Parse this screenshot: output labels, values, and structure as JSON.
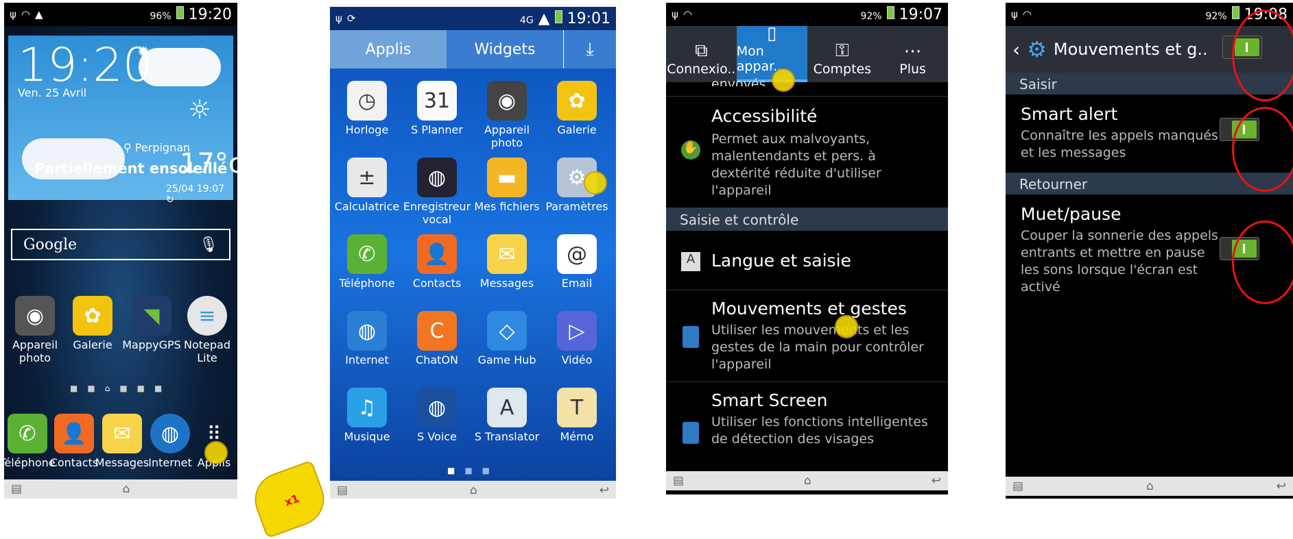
{
  "colors": {
    "accent": "#1fa0e8",
    "toggle": "#6ab42d",
    "annotation": "#e11111"
  },
  "screen1": {
    "status": {
      "battery": "96%",
      "time": "19:20"
    },
    "clock": "19:20",
    "date": "Ven. 25 Avril",
    "city": "Perpignan",
    "weather": "Partiellement ensoleillé",
    "temp": "17°c",
    "updated": "25/04 19:07",
    "search": "Google",
    "apps": [
      {
        "label": "Appareil photo",
        "icon": "camera-icon"
      },
      {
        "label": "Galerie",
        "icon": "gallery-icon"
      },
      {
        "label": "MappyGPS",
        "icon": "gps-icon"
      },
      {
        "label": "Notepad Lite",
        "icon": "notepad-icon"
      }
    ],
    "dock": [
      {
        "label": "Téléphone",
        "icon": "phone-icon"
      },
      {
        "label": "Contacts",
        "icon": "contacts-icon"
      },
      {
        "label": "Messages",
        "icon": "messages-icon"
      },
      {
        "label": "Internet",
        "icon": "globe-icon"
      },
      {
        "label": "Applis",
        "icon": "apps-icon"
      }
    ],
    "tap_count": "x1"
  },
  "screen2": {
    "status": {
      "network": "4G",
      "time": "19:01"
    },
    "tabs": [
      "Applis",
      "Widgets"
    ],
    "apps": [
      "Horloge",
      "S Planner",
      "Appareil photo",
      "Galerie",
      "Calculatrice",
      "Enregistreur vocal",
      "Mes fichiers",
      "Paramètres",
      "Téléphone",
      "Contacts",
      "Messages",
      "Email",
      "Internet",
      "ChatON",
      "Game Hub",
      "Vidéo",
      "Musique",
      "S Voice",
      "S Translator",
      "Mémo"
    ],
    "calendar_day": "31"
  },
  "screen3": {
    "status": {
      "battery": "92%",
      "time": "19:07"
    },
    "tabs": [
      "Connexio..",
      "Mon appar..",
      "Comptes",
      "Plus"
    ],
    "cut_text": "envoyés",
    "items": [
      {
        "title": "Accessibilité",
        "desc": "Permet aux malvoyants, malentendants et pers. à dextérité réduite d'utiliser l'appareil"
      },
      {
        "section": "Saisie et contrôle"
      },
      {
        "title": "Langue et saisie"
      },
      {
        "title": "Mouvements et gestes",
        "desc": "Utiliser les mouvements et les gestes de la main pour contrôler l'appareil"
      },
      {
        "title": "Smart Screen",
        "desc": "Utiliser les fonctions intelligentes de détection des visages"
      }
    ]
  },
  "screen4": {
    "status": {
      "battery": "92%",
      "time": "19:08"
    },
    "title": "Mouvements et g..",
    "sections": [
      "Saisir",
      "Retourner"
    ],
    "items": [
      {
        "title": "Smart alert",
        "desc": "Connaître les appels manqués et les messages"
      },
      {
        "title": "Muet/pause",
        "desc": "Couper la sonnerie des appels entrants et mettre en pause les sons lorsque l'écran est activé"
      }
    ]
  }
}
